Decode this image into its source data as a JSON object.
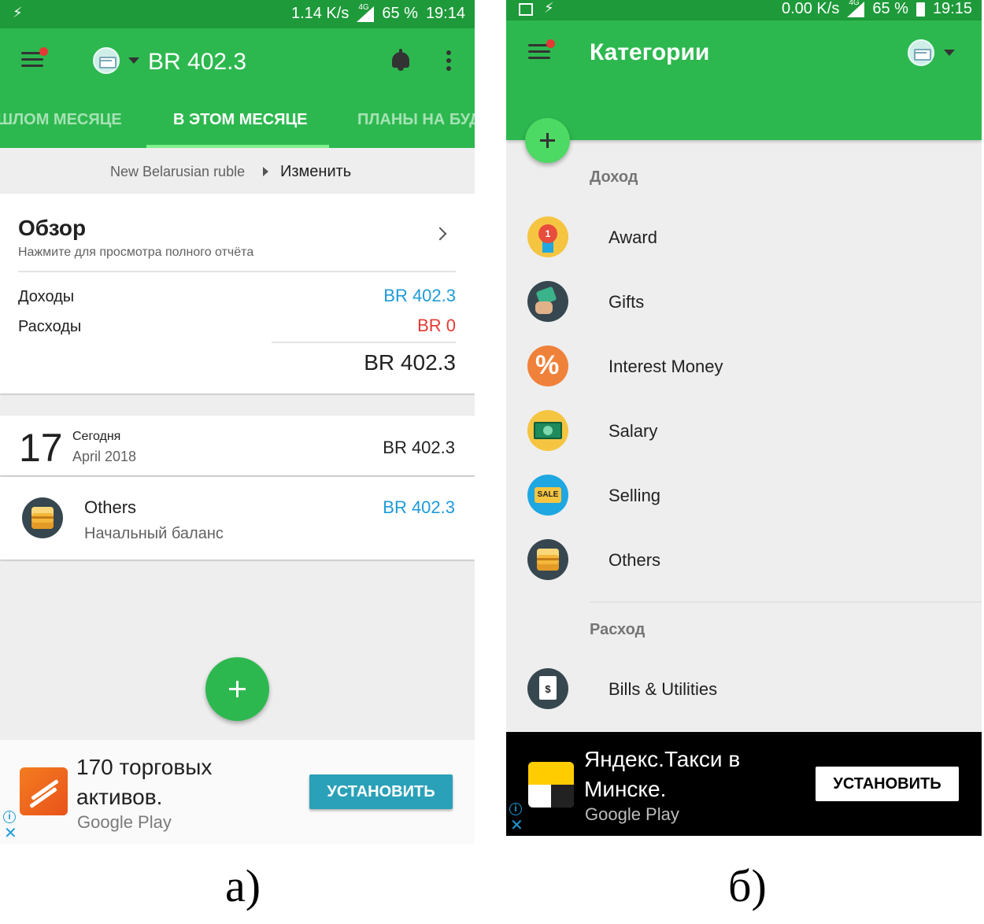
{
  "phone_a": {
    "status": {
      "speed": "1.14 K/s",
      "network": "4G",
      "battery": "65 %",
      "time": "19:14"
    },
    "appbar": {
      "balance": "BR 402.3"
    },
    "tabs": [
      {
        "label": "ШЛОМ МЕСЯЦЕ",
        "active": false
      },
      {
        "label": "В ЭТОМ МЕСЯЦЕ",
        "active": true
      },
      {
        "label": "ПЛАНЫ НА БУД",
        "active": false
      }
    ],
    "currency": {
      "name": "New Belarusian ruble",
      "change_label": "Изменить"
    },
    "overview": {
      "title": "Обзор",
      "subtitle": "Нажмите для просмотра полного отчёта",
      "income_label": "Доходы",
      "income_value": "BR 402.3",
      "expense_label": "Расходы",
      "expense_value": "BR 0",
      "total": "BR 402.3"
    },
    "day": {
      "number": "17",
      "label": "Сегодня",
      "month": "April 2018",
      "amount": "BR 402.3"
    },
    "entry": {
      "category": "Others",
      "note": "Начальный баланс",
      "amount": "BR 402.3"
    },
    "ad": {
      "headline_1": "170 торговых",
      "headline_2": "активов.",
      "store": "Google Play",
      "button": "УСТАНОВИТЬ"
    }
  },
  "phone_b": {
    "status": {
      "speed": "0.00 K/s",
      "network": "4G",
      "battery": "65 %",
      "time": "19:15"
    },
    "appbar": {
      "title": "Категории"
    },
    "income_section": "Доход",
    "income_categories": [
      {
        "name": "Award",
        "icon": "award-icon",
        "color": "#f5c542"
      },
      {
        "name": "Gifts",
        "icon": "gifts-icon",
        "color": "#37474f"
      },
      {
        "name": "Interest Money",
        "icon": "percent-icon",
        "color": "#f0813a"
      },
      {
        "name": "Salary",
        "icon": "money-icon",
        "color": "#f5c542"
      },
      {
        "name": "Selling",
        "icon": "sale-tag-icon",
        "color": "#1ea7e1"
      },
      {
        "name": "Others",
        "icon": "box-icon",
        "color": "#37474f"
      }
    ],
    "expense_section": "Расход",
    "expense_categories": [
      {
        "name": "Bills & Utilities",
        "icon": "bill-icon",
        "color": "#37474f"
      }
    ],
    "ad": {
      "headline_1": "Яндекс.Такси в",
      "headline_2": "Минске.",
      "store": "Google Play",
      "button": "УСТАНОВИТЬ",
      "sale_text": "SALE",
      "award_text": "1"
    }
  },
  "captions": {
    "a": "а)",
    "b": "б)"
  },
  "colors": {
    "green": "#2db84f",
    "status_green": "#1e9a3a",
    "blue": "#1e9bd8",
    "red": "#e53935"
  }
}
